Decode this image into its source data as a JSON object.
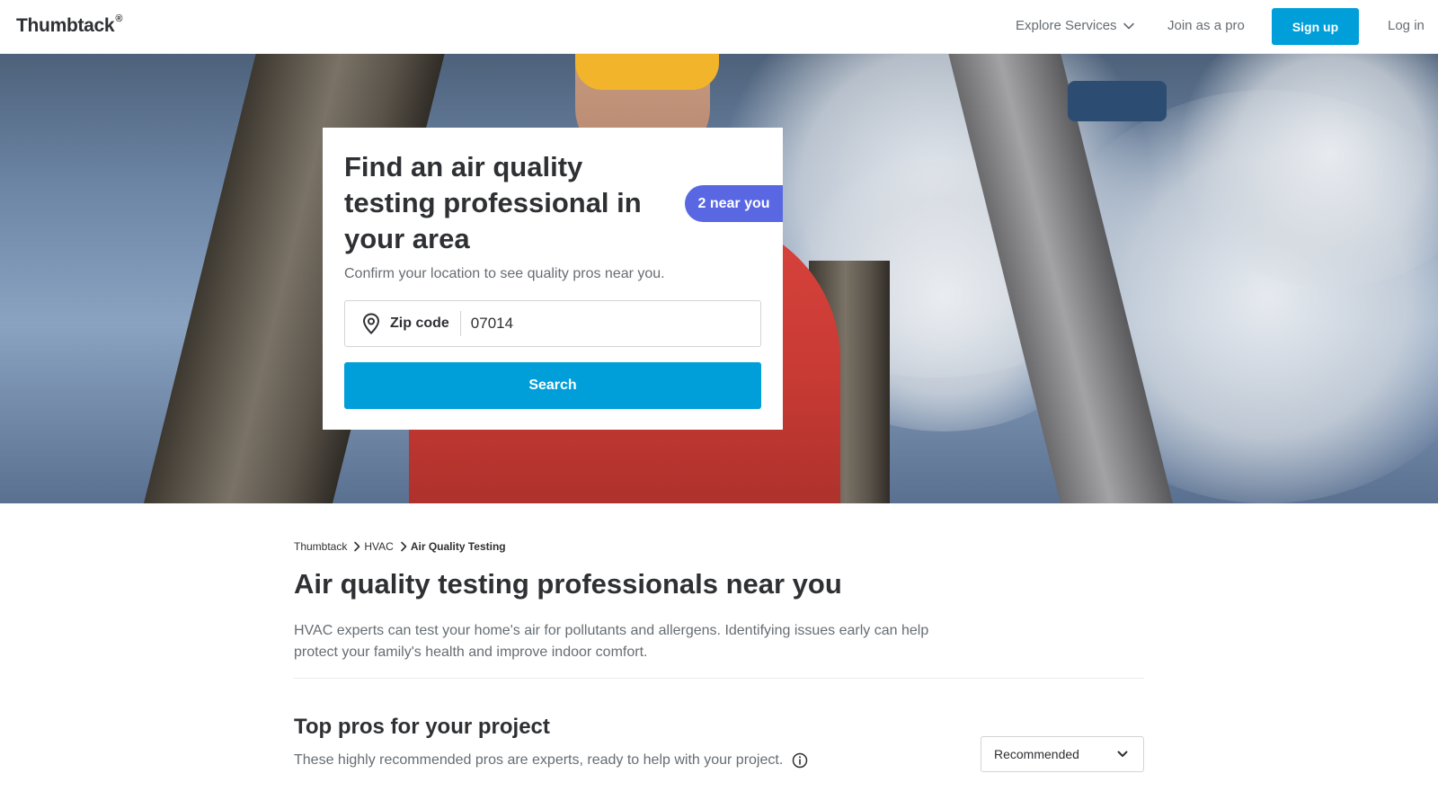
{
  "header": {
    "logo": "Thumbtack",
    "logo_mark": "®",
    "explore_label": "Explore Services",
    "join_label": "Join as a pro",
    "signup_label": "Sign up",
    "login_label": "Log in"
  },
  "hero": {
    "title": "Find an air quality testing professional in your area",
    "badge": "2 near you",
    "subtitle": "Confirm your location to see quality pros near you.",
    "zip_label": "Zip code",
    "zip_value": "07014",
    "search_label": "Search"
  },
  "breadcrumb": {
    "items": [
      "Thumbtack",
      "HVAC",
      "Air Quality Testing"
    ]
  },
  "main": {
    "title": "Air quality testing professionals near you",
    "description": "HVAC experts can test your home's air for pollutants and allergens. Identifying issues early can help protect your family's health and improve indoor comfort.",
    "section_title": "Top pros for your project",
    "section_subtitle": "These highly recommended pros are experts, ready to help with your project.",
    "sort_value": "Recommended"
  },
  "colors": {
    "brand_blue": "#009fd9",
    "badge_purple": "#5968e2",
    "text_dark": "#2f3033",
    "text_muted": "#676d73"
  },
  "icons": [
    "chevron-down-icon",
    "location-pin-icon",
    "chevron-right-icon",
    "info-icon"
  ]
}
